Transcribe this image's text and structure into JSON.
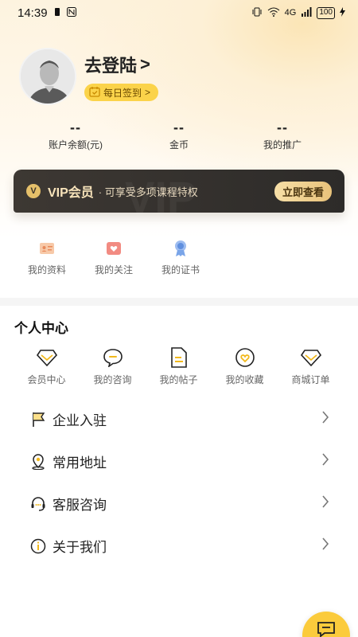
{
  "status_bar": {
    "time": "14:39",
    "network": "4G",
    "battery": "100"
  },
  "profile": {
    "login_text": "去登陆",
    "login_arrow": ">",
    "signin_label": "每日签到",
    "signin_arrow": ">"
  },
  "stats": [
    {
      "value": "--",
      "label": "账户余额(元)"
    },
    {
      "value": "--",
      "label": "金币"
    },
    {
      "value": "--",
      "label": "我的推广"
    }
  ],
  "vip": {
    "logo": "V",
    "title": "VIP会员",
    "subtitle": "· 可享受多项课程特权",
    "watermark": "VIP",
    "button": "立即查看"
  },
  "quick_links": [
    {
      "label": "我的资料",
      "icon": "profile-card-icon"
    },
    {
      "label": "我的关注",
      "icon": "heart-icon"
    },
    {
      "label": "我的证书",
      "icon": "certificate-icon"
    }
  ],
  "section_title": "个人中心",
  "grid_items": [
    {
      "label": "会员中心",
      "icon": "diamond-icon"
    },
    {
      "label": "我的咨询",
      "icon": "chat-icon"
    },
    {
      "label": "我的帖子",
      "icon": "document-icon"
    },
    {
      "label": "我的收藏",
      "icon": "favorite-icon"
    },
    {
      "label": "商城订单",
      "icon": "diamond-order-icon"
    }
  ],
  "menu_items": [
    {
      "label": "企业入驻",
      "icon": "flag-icon"
    },
    {
      "label": "常用地址",
      "icon": "location-icon"
    },
    {
      "label": "客服咨询",
      "icon": "headset-icon"
    },
    {
      "label": "关于我们",
      "icon": "info-icon"
    }
  ],
  "colors": {
    "accent": "#fbd34a",
    "vip_bg": "#2d2b29",
    "vip_text": "#f8e4bb",
    "icon_pink": "#f28b82",
    "icon_blue": "#7aa5e8"
  }
}
